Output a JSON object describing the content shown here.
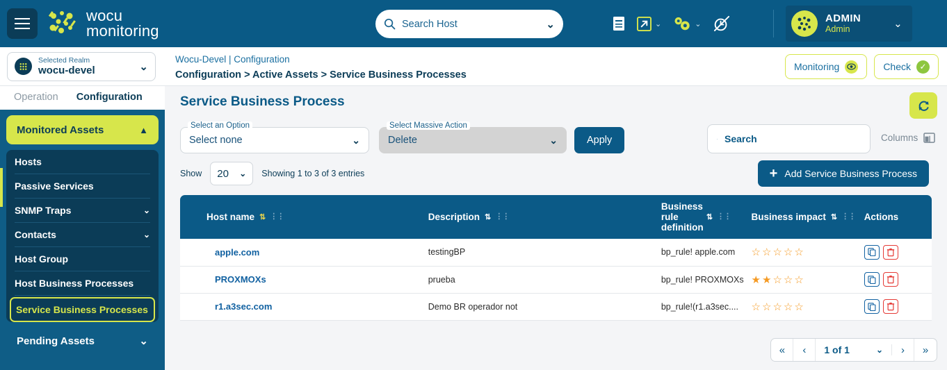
{
  "topbar": {
    "menu_icon": "hamburger-icon",
    "brand_line1": "wocu",
    "brand_line2": "monitoring",
    "host_search_placeholder": "Search Host",
    "host_search_value": "",
    "icons": [
      "document-icon",
      "external-link-icon",
      "gears-icon",
      "clock-off-icon"
    ],
    "user_name": "ADMIN",
    "user_role": "Admin"
  },
  "subheader": {
    "realm_label": "Selected Realm",
    "realm_value": "wocu-devel",
    "crumb_top": "Wocu-Devel | Configuration",
    "crumb_main": "Configuration > Active Assets > Service Business Processes",
    "monitoring_label": "Monitoring",
    "check_label": "Check"
  },
  "sidebar": {
    "tabs": [
      {
        "label": "Operation",
        "active": false
      },
      {
        "label": "Configuration",
        "active": true
      }
    ],
    "accordion_label": "Monitored Assets",
    "items": [
      {
        "label": "Hosts",
        "chevron": ""
      },
      {
        "label": "Passive Services",
        "chevron": ""
      },
      {
        "label": "SNMP Traps",
        "chevron": "⌄"
      },
      {
        "label": "Contacts",
        "chevron": "⌄"
      },
      {
        "label": "Host Group",
        "chevron": ""
      },
      {
        "label": "Host Business Processes",
        "chevron": ""
      },
      {
        "label": "Service Business Processes",
        "chevron": "",
        "selected": true
      }
    ],
    "pending_label": "Pending Assets"
  },
  "main": {
    "page_title": "Service Business Process",
    "refresh_icon": "refresh-icon",
    "select_option_label": "Select an Option",
    "select_option_value": "Select none",
    "massive_action_label": "Select Massive Action",
    "massive_action_value": "Delete",
    "apply_label": "Apply",
    "search_placeholder": "Search",
    "search_value": "",
    "columns_label": "Columns",
    "show_label": "Show",
    "show_value": "20",
    "showing_text": "Showing 1 to 3 of 3 entries",
    "add_label": "Add Service Business Process"
  },
  "table": {
    "columns": [
      {
        "label": "Host name",
        "sortable": true,
        "sort_active": true
      },
      {
        "label": "Description",
        "sortable": true,
        "sort_active": false
      },
      {
        "label": "Business rule definition",
        "sortable": true,
        "sort_active": false
      },
      {
        "label": "Business impact",
        "sortable": true,
        "sort_active": false
      },
      {
        "label": "Actions",
        "sortable": false,
        "sort_active": false
      }
    ],
    "rows": [
      {
        "host": "apple.com",
        "description": "testingBP",
        "rule": "bp_rule! apple.com",
        "impact": 0,
        "impact_stars": "☆☆☆☆☆"
      },
      {
        "host": "PROXMOXs",
        "description": "prueba",
        "rule": "bp_rule! PROXMOXs",
        "impact": 2,
        "impact_stars": "★★☆☆☆"
      },
      {
        "host": "r1.a3sec.com",
        "description": "Demo BR operador not",
        "rule": "bp_rule!(r1.a3sec....",
        "impact": 0,
        "impact_stars": "☆☆☆☆☆"
      }
    ]
  },
  "pagination": {
    "first": "«",
    "prev": "‹",
    "page_text": "1 of 1",
    "next": "›",
    "last": "»"
  },
  "colors": {
    "brand_blue": "#0a5a86",
    "dark_blue": "#0b3c57",
    "accent_yellow": "#d7e64b",
    "link_blue": "#1161a1",
    "star_orange": "#f59a23",
    "danger_red": "#e53935"
  }
}
